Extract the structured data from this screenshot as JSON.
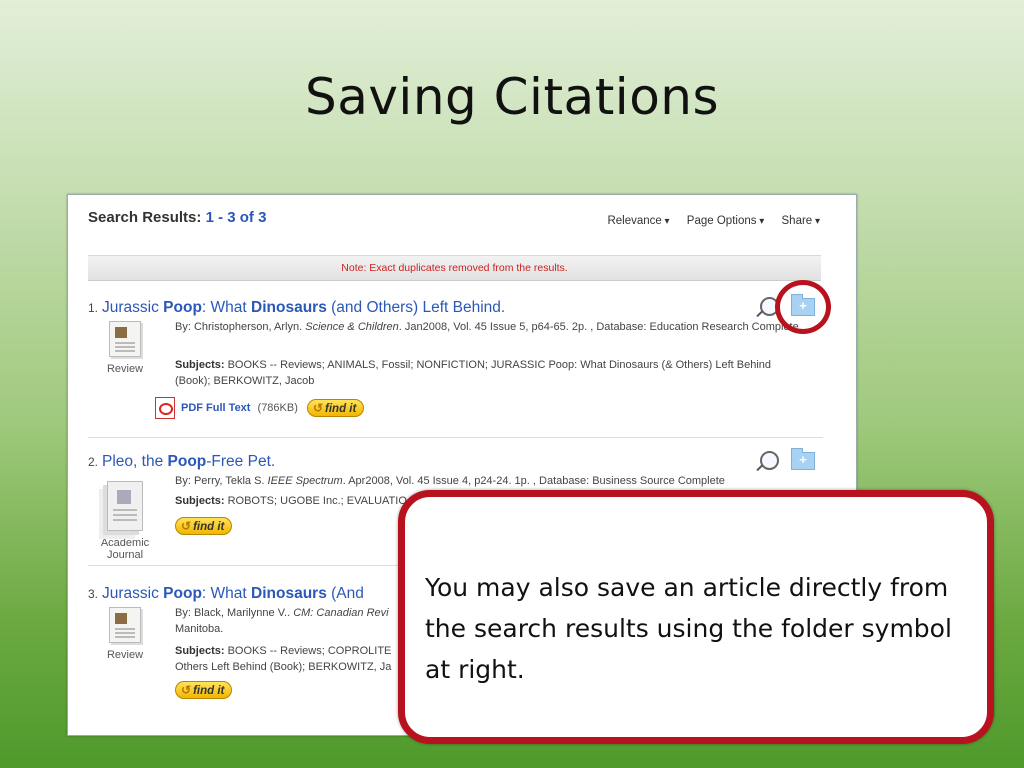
{
  "slide": {
    "title": "Saving Citations"
  },
  "search": {
    "heading_label": "Search Results:",
    "heading_count": "1 - 3 of 3",
    "options": [
      "Relevance",
      "Page Options",
      "Share"
    ],
    "note": "Note: Exact duplicates removed from the results."
  },
  "results": [
    {
      "number": "1.",
      "title_parts": [
        "Jurassic ",
        "Poop",
        ": What ",
        "Dinosaurs",
        " (and Others) Left Behind."
      ],
      "by": "By: Christopherson, Arlyn. ",
      "source": "Science & Children",
      "details": ". Jan2008, Vol. 45 Issue 5, p64-65. 2p. , Database: Education Research Complete",
      "subjects_label": "Subjects:",
      "subjects": " BOOKS -- Reviews; ANIMALS, Fossil; NONFICTION; JURASSIC Poop: What Dinosaurs (& Others) Left Behind (Book); BERKOWITZ, Jacob",
      "pub_type": "Review",
      "pdf_label": "PDF Full Text",
      "pdf_size": "(786KB)",
      "findit_label": "find it"
    },
    {
      "number": "2.",
      "title_parts": [
        "Pleo, the ",
        "Poop",
        "-Free Pet."
      ],
      "by": "By: Perry, Tekla S. ",
      "source": "IEEE Spectrum",
      "details": ". Apr2008, Vol. 45 Issue 4, p24-24. 1p. , Database: Business Source Complete",
      "subjects_label": "Subjects:",
      "subjects": " ROBOTS; UGOBE Inc.; EVALUATIO",
      "pub_type_line1": "Academic",
      "pub_type_line2": "Journal",
      "findit_label": "find it"
    },
    {
      "number": "3.",
      "title_parts": [
        "Jurassic ",
        "Poop",
        ": What ",
        "Dinosaurs",
        " (And"
      ],
      "by": "By: Black, Marilynne V.. ",
      "source": "CM: Canadian Revi",
      "details_line2": "Manitoba.",
      "subjects_label": "Subjects:",
      "subjects": " BOOKS -- Reviews; COPROLITE",
      "subjects_line2": "Others Left Behind (Book); BERKOWITZ, Ja",
      "pub_type": "Review",
      "findit_label": "find it"
    }
  ],
  "callout": {
    "text": "You may also save an article directly from the search results using the folder symbol at right."
  },
  "colors": {
    "accent_red": "#b8121e",
    "link_blue": "#2b58b8"
  },
  "icons": [
    "magnifier-icon",
    "add-to-folder-icon",
    "pdf-icon",
    "review-document-icon",
    "journal-icon"
  ]
}
